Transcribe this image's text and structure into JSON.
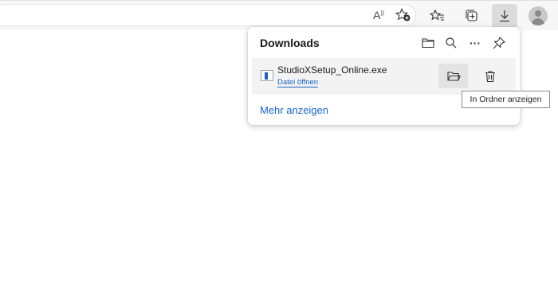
{
  "toolbar": {
    "read_aloud_label": "A",
    "icons": [
      "read-aloud-icon",
      "add-favorite-icon",
      "favorites-icon",
      "collections-icon",
      "download-icon",
      "profile-avatar-icon"
    ]
  },
  "downloads_panel": {
    "title": "Downloads",
    "header_icons": [
      "open-folder-icon",
      "search-icon",
      "more-options-icon",
      "pin-icon"
    ],
    "more_glyph": "···",
    "items": [
      {
        "file_name": "StudioXSetup_Online.exe",
        "action_link": "Datei öffnen",
        "icons": [
          "file-exe-icon",
          "show-in-folder-icon",
          "delete-icon"
        ]
      }
    ],
    "show_more_link": "Mehr anzeigen"
  },
  "tooltip": {
    "text": "In Ordner anzeigen"
  },
  "colors": {
    "accent": "#1a63c2",
    "toolbar_bg": "#f7f7f7",
    "active_button_bg": "#dcdcdc",
    "item_bg": "#f3f3f3"
  }
}
